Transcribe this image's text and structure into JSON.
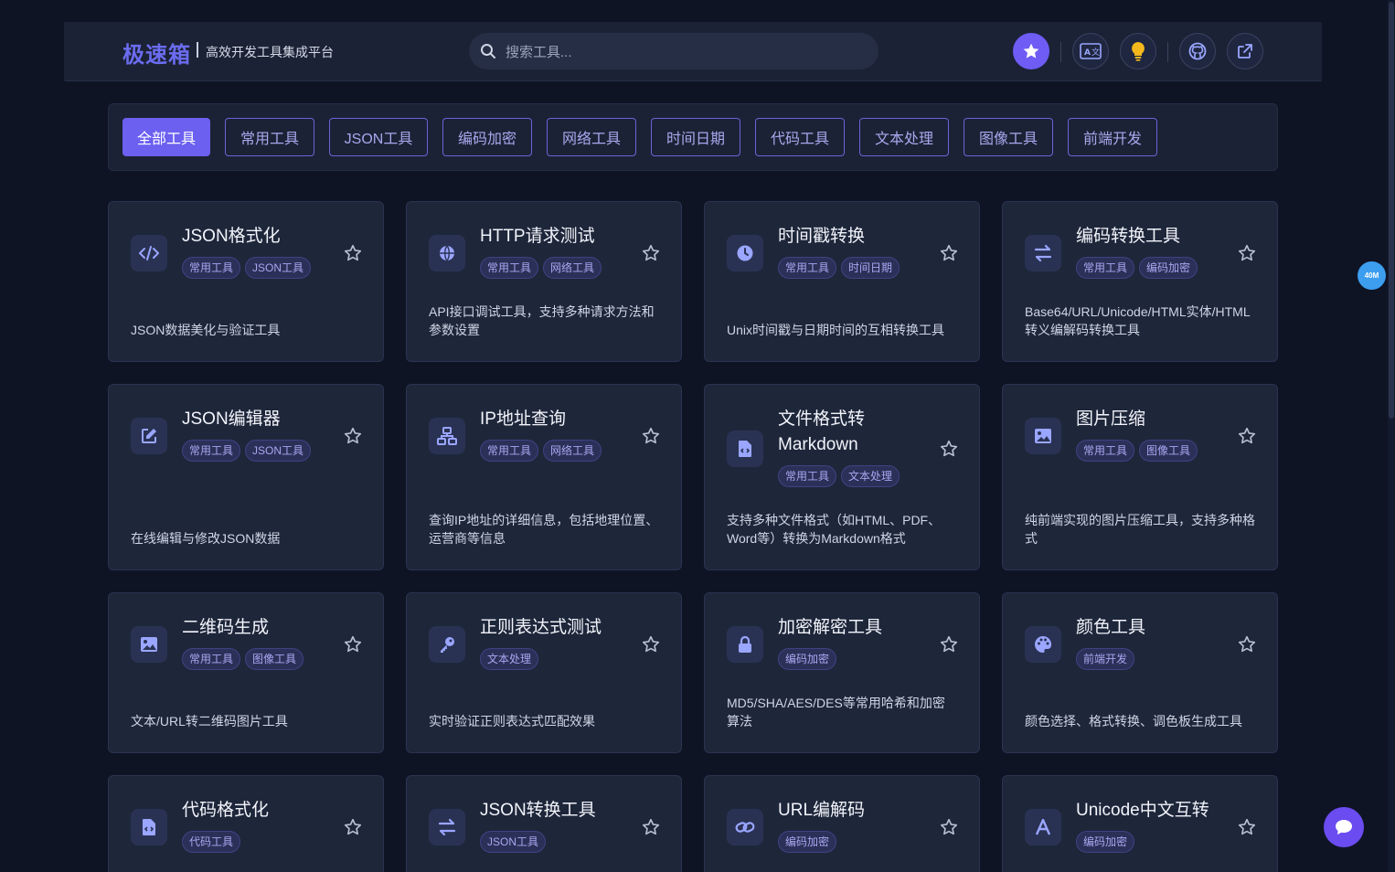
{
  "brand": {
    "logo": "极速箱",
    "subtitle": "高效开发工具集成平台"
  },
  "search": {
    "placeholder": "搜索工具..."
  },
  "header_buttons": [
    "star-icon",
    "translate-icon",
    "lightbulb-icon",
    "github-icon",
    "external-link-icon"
  ],
  "categories": [
    "全部工具",
    "常用工具",
    "JSON工具",
    "编码加密",
    "网络工具",
    "时间日期",
    "代码工具",
    "文本处理",
    "图像工具",
    "前端开发"
  ],
  "active_category": "全部工具",
  "tools": [
    {
      "title": "JSON格式化",
      "tags": [
        "常用工具",
        "JSON工具"
      ],
      "desc": "JSON数据美化与验证工具",
      "icon": "code-icon"
    },
    {
      "title": "HTTP请求测试",
      "tags": [
        "常用工具",
        "网络工具"
      ],
      "desc": "API接口调试工具，支持多种请求方法和参数设置",
      "icon": "globe-icon"
    },
    {
      "title": "时间戳转换",
      "tags": [
        "常用工具",
        "时间日期"
      ],
      "desc": "Unix时间戳与日期时间的互相转换工具",
      "icon": "clock-icon"
    },
    {
      "title": "编码转换工具",
      "tags": [
        "常用工具",
        "编码加密"
      ],
      "desc": "Base64/URL/Unicode/HTML实体/HTML转义编解码转换工具",
      "icon": "exchange-icon"
    },
    {
      "title": "JSON编辑器",
      "tags": [
        "常用工具",
        "JSON工具"
      ],
      "desc": "在线编辑与修改JSON数据",
      "icon": "edit-icon"
    },
    {
      "title": "IP地址查询",
      "tags": [
        "常用工具",
        "网络工具"
      ],
      "desc": "查询IP地址的详细信息，包括地理位置、运营商等信息",
      "icon": "network-icon"
    },
    {
      "title": "文件格式转Markdown",
      "tags": [
        "常用工具",
        "文本处理"
      ],
      "desc": "支持多种文件格式（如HTML、PDF、Word等）转换为Markdown格式",
      "icon": "file-code-icon"
    },
    {
      "title": "图片压缩",
      "tags": [
        "常用工具",
        "图像工具"
      ],
      "desc": "纯前端实现的图片压缩工具，支持多种格式",
      "icon": "image-icon"
    },
    {
      "title": "二维码生成",
      "tags": [
        "常用工具",
        "图像工具"
      ],
      "desc": "文本/URL转二维码图片工具",
      "icon": "image-icon"
    },
    {
      "title": "正则表达式测试",
      "tags": [
        "文本处理"
      ],
      "desc": "实时验证正则表达式匹配效果",
      "icon": "key-icon"
    },
    {
      "title": "加密解密工具",
      "tags": [
        "编码加密"
      ],
      "desc": "MD5/SHA/AES/DES等常用哈希和加密算法",
      "icon": "lock-icon"
    },
    {
      "title": "颜色工具",
      "tags": [
        "前端开发"
      ],
      "desc": "颜色选择、格式转换、调色板生成工具",
      "icon": "palette-icon"
    },
    {
      "title": "代码格式化",
      "tags": [
        "代码工具"
      ],
      "desc": "",
      "icon": "file-code-icon"
    },
    {
      "title": "JSON转换工具",
      "tags": [
        "JSON工具"
      ],
      "desc": "",
      "icon": "exchange-icon"
    },
    {
      "title": "URL编解码",
      "tags": [
        "编码加密"
      ],
      "desc": "",
      "icon": "link-icon"
    },
    {
      "title": "Unicode中文互转",
      "tags": [
        "编码加密"
      ],
      "desc": "",
      "icon": "font-icon"
    }
  ],
  "float_badge": "40M",
  "colors": {
    "bg": "#0f1425",
    "card": "#1e263a",
    "accent": "#6b60f0",
    "tag_text": "#a9a7f0"
  }
}
